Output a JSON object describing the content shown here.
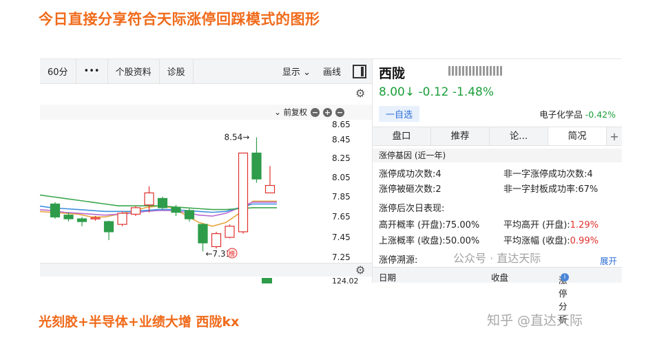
{
  "headline": "今日直接分享符合天际涨停回踩模式的图形",
  "toolbar": {
    "period": "60分",
    "more": "•••",
    "stock_info": "个股资料",
    "diagnose": "诊股",
    "display": "显示",
    "draw": "画线"
  },
  "chart": {
    "adjust": "前复权",
    "price_ticks": [
      "8.65",
      "8.45",
      "8.25",
      "8.05",
      "7.85",
      "7.65",
      "7.45",
      "7.25"
    ],
    "high_label": "8.54→",
    "low_label": "←7.31",
    "badge": "榜",
    "volume_label": "124.02"
  },
  "chart_data": {
    "type": "candlestick",
    "ylim": [
      7.2,
      8.7
    ],
    "candles": [
      {
        "open": 7.82,
        "close": 7.68,
        "high": 7.84,
        "low": 7.66
      },
      {
        "open": 7.7,
        "close": 7.66,
        "high": 7.73,
        "low": 7.63
      },
      {
        "open": 7.66,
        "close": 7.63,
        "high": 7.68,
        "low": 7.58
      },
      {
        "open": 7.66,
        "close": 7.67,
        "high": 7.69,
        "low": 7.64
      },
      {
        "open": 7.63,
        "close": 7.52,
        "high": 7.64,
        "low": 7.43
      },
      {
        "open": 7.6,
        "close": 7.72,
        "high": 7.74,
        "low": 7.58
      },
      {
        "open": 7.71,
        "close": 7.78,
        "high": 7.8,
        "low": 7.69
      },
      {
        "open": 7.81,
        "close": 7.94,
        "high": 8.01,
        "low": 7.73
      },
      {
        "open": 7.88,
        "close": 7.78,
        "high": 7.9,
        "low": 7.76
      },
      {
        "open": 7.78,
        "close": 7.73,
        "high": 7.81,
        "low": 7.69
      },
      {
        "open": 7.75,
        "close": 7.66,
        "high": 7.77,
        "low": 7.63
      },
      {
        "open": 7.6,
        "close": 7.4,
        "high": 7.61,
        "low": 7.31
      },
      {
        "open": 7.36,
        "close": 7.5,
        "high": 7.52,
        "low": 7.34
      },
      {
        "open": 7.46,
        "close": 7.58,
        "high": 7.6,
        "low": 7.45
      },
      {
        "open": 7.52,
        "close": 8.37,
        "high": 8.37,
        "low": 7.5
      },
      {
        "open": 8.37,
        "close": 8.09,
        "high": 8.54,
        "low": 8.05
      },
      {
        "open": 7.94,
        "close": 8.02,
        "high": 8.23,
        "low": 7.94
      }
    ],
    "ma": [
      {
        "color": "#e8a33c",
        "values": [
          7.74,
          7.73,
          7.72,
          7.71,
          7.68,
          7.68,
          7.71,
          7.74,
          7.78,
          7.8,
          7.78,
          7.7,
          7.62,
          7.58,
          7.62,
          7.72,
          7.85
        ]
      },
      {
        "color": "#b96ad0",
        "values": [
          7.76,
          7.75,
          7.73,
          7.72,
          7.71,
          7.7,
          7.71,
          7.72,
          7.74,
          7.75,
          7.75,
          7.73,
          7.7,
          7.69,
          7.72,
          7.78,
          7.84
        ]
      },
      {
        "color": "#3f8fe0",
        "values": [
          7.8,
          7.78,
          7.77,
          7.76,
          7.75,
          7.74,
          7.74,
          7.74,
          7.75,
          7.76,
          7.76,
          7.75,
          7.74,
          7.73,
          7.74,
          7.78,
          7.82
        ]
      },
      {
        "color": "#3aa64c",
        "values": [
          7.92,
          7.9,
          7.88,
          7.86,
          7.84,
          7.82,
          7.8,
          7.8,
          7.8,
          7.8,
          7.79,
          7.78,
          7.77,
          7.76,
          7.76,
          7.77,
          7.78
        ]
      }
    ]
  },
  "stock": {
    "name": "西陇",
    "price_line": "8.00↓ -0.12 -1.48%",
    "watch": "一自选",
    "sector": "电子化学品",
    "sector_change": "-0.42%"
  },
  "tabs": [
    "盘口",
    "推荐",
    "论...",
    "简况"
  ],
  "tab_plus": "+",
  "limit_gene": {
    "header": "涨停基因 (近一年)",
    "success": "涨停成功次数:4",
    "non_one_success": "非一字涨停成功次数:4",
    "broken": "涨停被砸次数:2",
    "non_one_rate": "非一字封板成功率:67%"
  },
  "after_limit": {
    "header": "涨停后次日表现:",
    "high_open_label": "高开概率 (开盘):75.00%",
    "avg_high_label": "平均高开 (开盘):",
    "avg_high_value": "1.29%",
    "rise_label": "上涨概率 (收盘):50.00%",
    "avg_rise_label": "平均涨幅 (收盘):",
    "avg_rise_value": "0.99%"
  },
  "trace": {
    "header": "涨停溯源:",
    "expand": "展开",
    "col_date": "日期",
    "col_close": "收盘",
    "col_analysis": "涨停分析",
    "info_icon": "i"
  },
  "watermark": {
    "top": "公众号 · 直达天际",
    "bottom": "知乎 @直达天际"
  },
  "footer": "光刻胶+半导体+业绩大增 西陇kx"
}
